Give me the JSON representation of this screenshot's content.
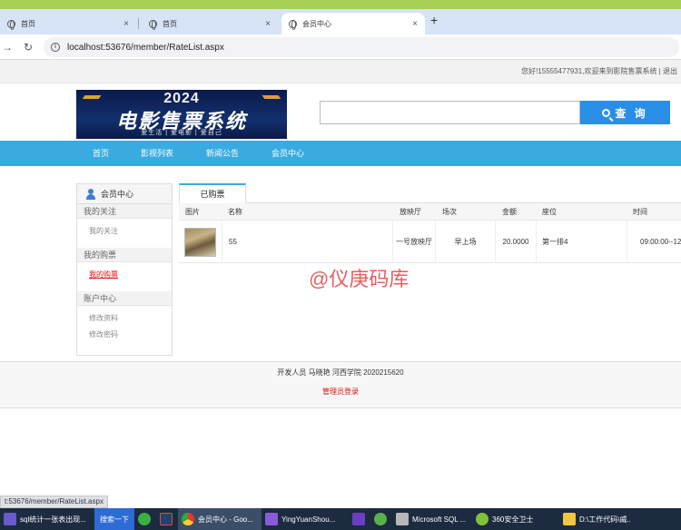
{
  "browser": {
    "tabs": [
      {
        "title": "首页"
      },
      {
        "title": "首页"
      },
      {
        "title": "会员中心"
      }
    ],
    "close_glyph": "×",
    "new_tab_glyph": "+",
    "url": "localhost:53676/member/RateList.aspx",
    "status_url": "t:53676/member/RateList.aspx"
  },
  "site": {
    "welcome": "您好!15555477931,欢迎来到影院售票系统 | 退出",
    "banner": {
      "year": "2024",
      "name": "电影售票系统",
      "slogan": "爱生活 | 爱电影 | 爱自己"
    },
    "search": {
      "button_label": "查 询",
      "placeholder": ""
    },
    "nav": [
      "首页",
      "影视列表",
      "新闻公告",
      "会员中心"
    ]
  },
  "sidebar": {
    "title": "会员中心",
    "sections": [
      {
        "title": "我的关注",
        "links": [
          {
            "label": "我的关注",
            "active": false
          }
        ]
      },
      {
        "title": "我的购票",
        "links": [
          {
            "label": "我的购票",
            "active": true
          }
        ]
      },
      {
        "title": "账户中心",
        "links": [
          {
            "label": "修改资料",
            "active": false
          },
          {
            "label": "修改密码",
            "active": false
          }
        ]
      }
    ]
  },
  "content": {
    "tab": "已购票",
    "columns": [
      "图片",
      "名称",
      "放映厅",
      "场次",
      "金额",
      "座位",
      "时间"
    ],
    "rows": [
      {
        "name": "55",
        "hall": "一号放映厅",
        "session": "早上场",
        "amount": "20.0000",
        "seat": "第一排4",
        "time": "09:00:00--12"
      }
    ]
  },
  "watermark": "@仪庚码库",
  "footer": {
    "developer": "开发人员 马晓艳 河西学院 2020215620",
    "admin_link": "管理员登录"
  },
  "taskbar": {
    "items": [
      {
        "label": "sql统计一张表出现...",
        "icon": "ai-icon",
        "color": "#6a5acd"
      },
      {
        "label": "搜索一下",
        "icon": "search-box",
        "color": "#2d6bd6"
      },
      {
        "label": "",
        "icon": "app-green-icon",
        "color": "#3cb043"
      },
      {
        "label": "",
        "icon": "app-dark-icon",
        "color": "#23406e"
      },
      {
        "label": "会员中心 - Goo...",
        "icon": "chrome-icon",
        "color": "#e8b630"
      },
      {
        "label": "YingYuanShou...",
        "icon": "visual-studio-icon",
        "color": "#8a5bd6"
      },
      {
        "label": "",
        "icon": "vs-icon",
        "color": "#6b3fc4"
      },
      {
        "label": "",
        "icon": "app-green2-icon",
        "color": "#5ab14a"
      },
      {
        "label": "Microsoft SQL ...",
        "icon": "sql-server-icon",
        "color": "#b8b8b8"
      },
      {
        "label": "360安全卫士",
        "icon": "360-icon",
        "color": "#7fc23a"
      },
      {
        "label": "D:\\工作代码\\威...",
        "icon": "folder-icon",
        "color": "#f0c640"
      }
    ]
  }
}
